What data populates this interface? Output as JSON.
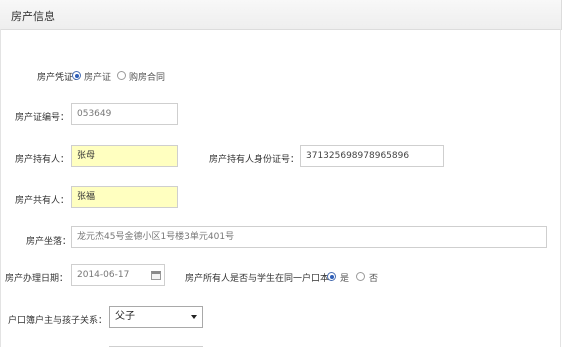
{
  "panel": {
    "title": "房产信息"
  },
  "form": {
    "certificate_type": {
      "label": "房产凭证：",
      "options": [
        "房产证",
        "购房合同"
      ],
      "selected": "房产证"
    },
    "certificate_number": {
      "label": "房产证编号：",
      "value": "053649"
    },
    "holder": {
      "label": "房产持有人：",
      "value": "张母"
    },
    "holder_id": {
      "label": "房产持有人身份证号：",
      "value": "371325698978965896"
    },
    "co_owner": {
      "label": "房产共有人：",
      "value": "张福"
    },
    "location": {
      "label": "房产坐落：",
      "value": "龙元杰45号金德小区1号楼3单元401号"
    },
    "issue_date": {
      "label": "房产办理日期：",
      "value": "2014-06-17"
    },
    "same_household": {
      "label": "房产所有人是否与学生在同一户口本：",
      "options": [
        "是",
        "否"
      ],
      "selected": "是"
    },
    "relation": {
      "label": "户口簿户主与孩子关系：",
      "value": "父子"
    }
  },
  "icons": {
    "calendar": "calendar-icon",
    "dropdown": "chevron-down-icon"
  }
}
